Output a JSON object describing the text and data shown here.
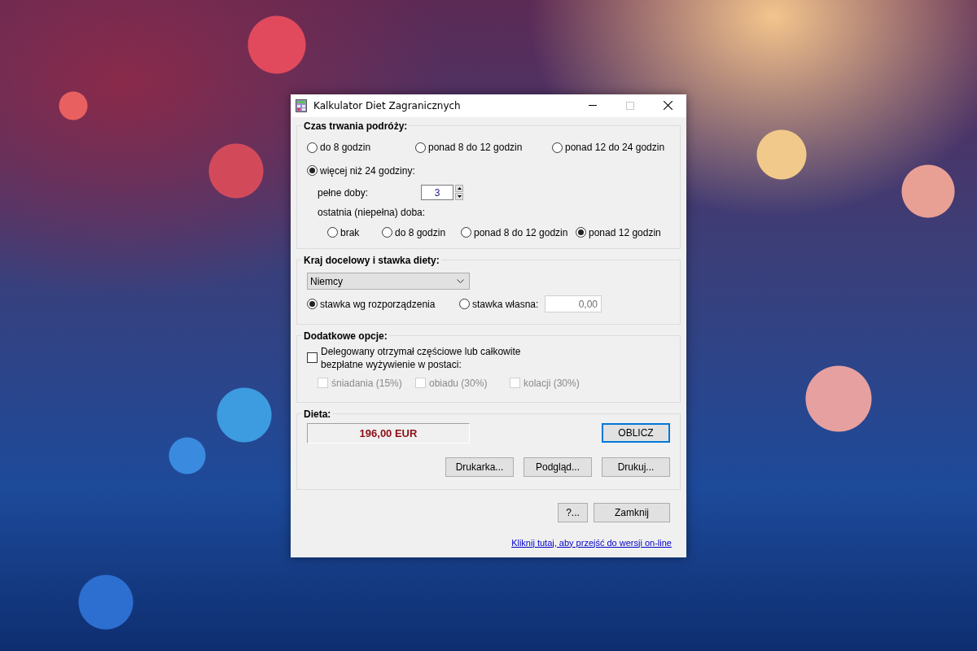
{
  "window": {
    "title": "Kalkulator Diet Zagranicznych"
  },
  "duration": {
    "title": "Czas trwania podróży:",
    "options": [
      {
        "label": "do 8 godzin",
        "selected": false
      },
      {
        "label": "ponad 8 do 12 godzin",
        "selected": false
      },
      {
        "label": "ponad 12 do 24 godzin",
        "selected": false
      },
      {
        "label": "więcej niż 24 godziny:",
        "selected": true
      }
    ],
    "full_days": {
      "label": "pełne doby:",
      "value": "3"
    },
    "last_day": {
      "label": "ostatnia (niepełna) doba:",
      "options": [
        {
          "label": "brak",
          "selected": false
        },
        {
          "label": "do 8 godzin",
          "selected": false
        },
        {
          "label": "ponad 8 do 12 godzin",
          "selected": false
        },
        {
          "label": "ponad 12 godzin",
          "selected": true
        }
      ]
    }
  },
  "country": {
    "title": "Kraj docelowy i stawka diety:",
    "select": {
      "value": "Niemcy"
    },
    "rate_options": [
      {
        "label": "stawka wg rozporządzenia",
        "selected": true
      },
      {
        "label": "stawka własna:",
        "selected": false
      }
    ],
    "own_rate": {
      "value": "0,00"
    }
  },
  "extras": {
    "title": "Dodatkowe opcje:",
    "meals_received": {
      "label": "Delegowany otrzymał częściowe lub całkowite\nbezpłatne wyżywienie w postaci:",
      "checked": false
    },
    "meals": [
      {
        "label": "śniadania (15%)",
        "checked": false,
        "disabled": true
      },
      {
        "label": "obiadu (30%)",
        "checked": false,
        "disabled": true
      },
      {
        "label": "kolacji (30%)",
        "checked": false,
        "disabled": true
      }
    ]
  },
  "result": {
    "title": "Dieta:",
    "value": "196,00 EUR",
    "calculate": {
      "label": "OBLICZ",
      "focused": true
    },
    "buttons": [
      {
        "label": "Drukarka...",
        "focused": false
      },
      {
        "label": "Podgląd...",
        "focused": false
      },
      {
        "label": "Drukuj...",
        "focused": false
      }
    ]
  },
  "footer": {
    "buttons": [
      {
        "label": "?...",
        "focused": false
      },
      {
        "label": "Zamknij",
        "focused": false
      }
    ],
    "link": "Kliknij tutaj, aby przejść do wersji on-line"
  }
}
